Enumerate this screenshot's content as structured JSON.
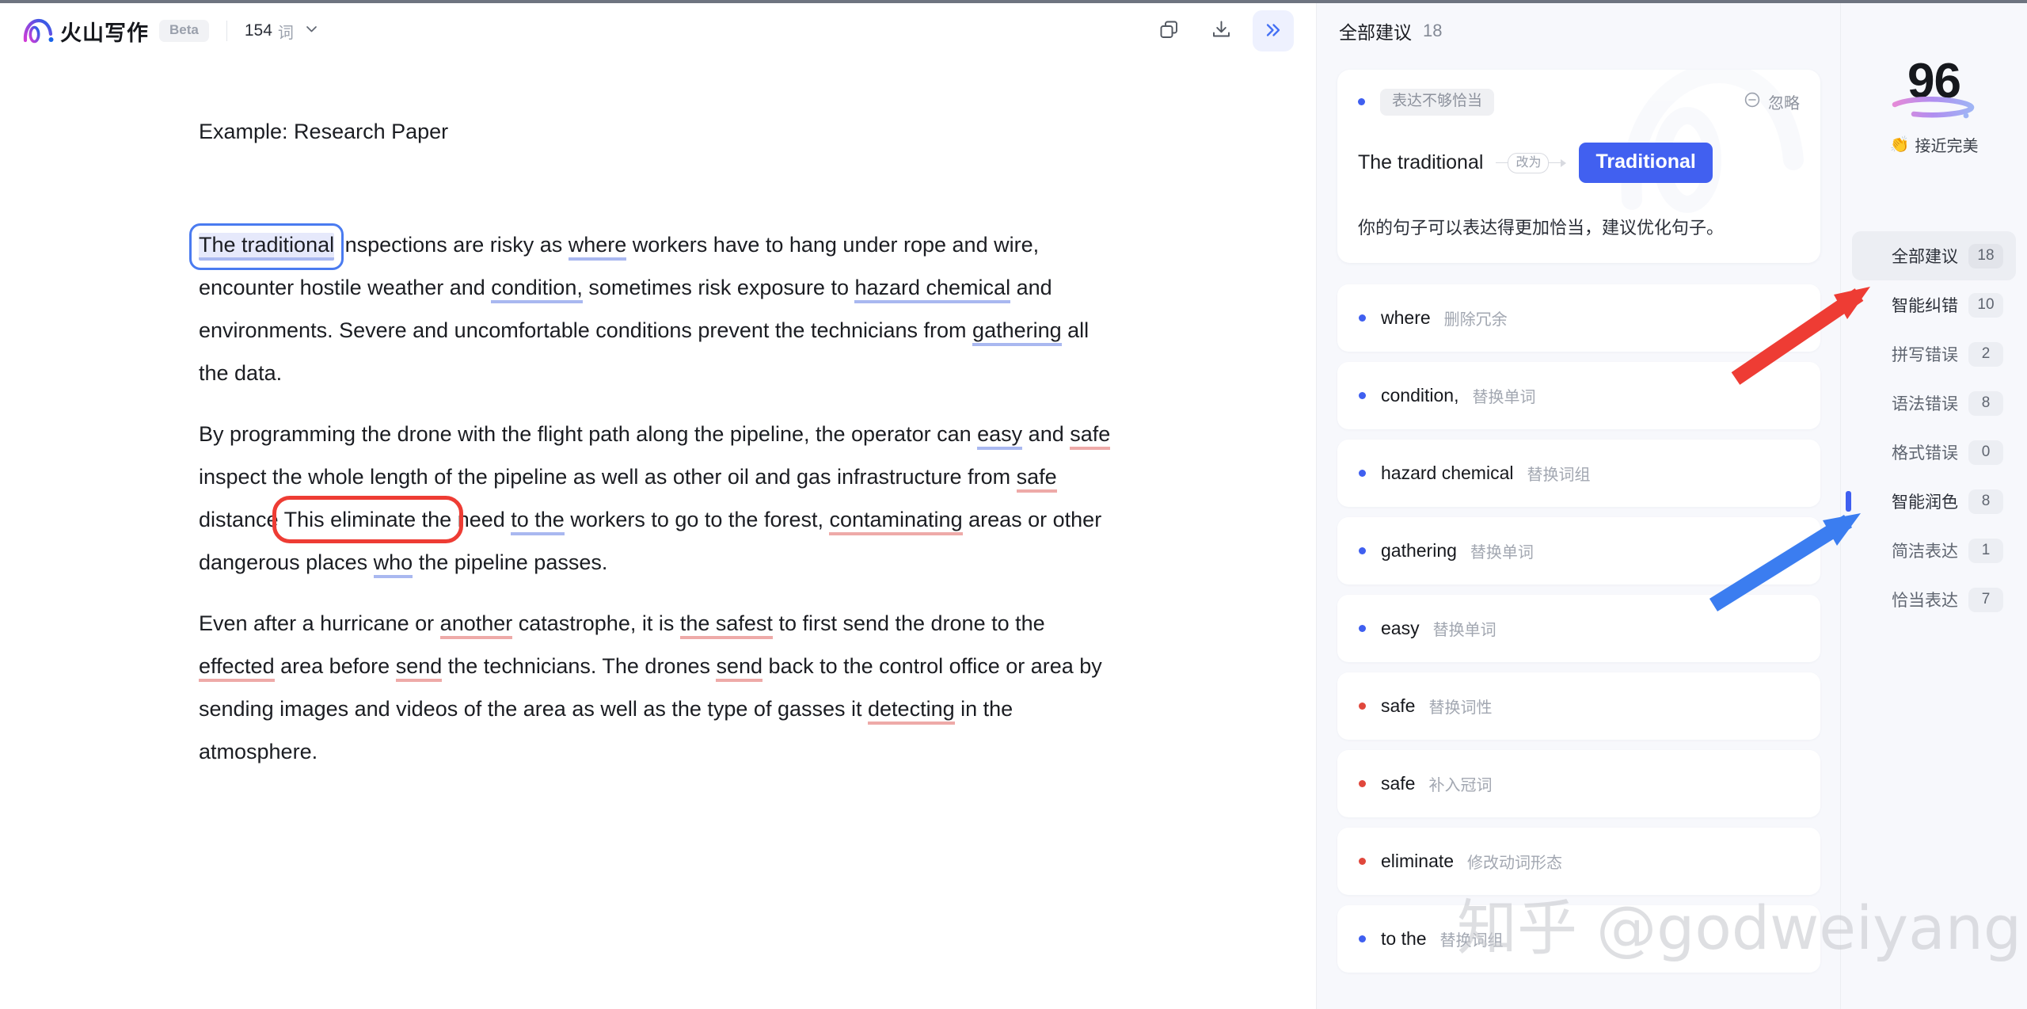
{
  "app": {
    "brand_name": "火山写作",
    "beta_label": "Beta",
    "word_count": "154",
    "word_unit": "词",
    "watermark": "知乎 @godweiyang"
  },
  "toolbar": {
    "copy_icon": "copy-icon",
    "download_icon": "download-icon",
    "collapse_icon": "double-chevron-right-icon"
  },
  "document": {
    "title": "Example: Research Paper",
    "paragraphs": [
      {
        "id": "p1",
        "runs": [
          {
            "t": "The traditional",
            "style": "selected"
          },
          {
            "t": " inspections are risky as ",
            "style": "plain"
          },
          {
            "t": "where",
            "style": "blue"
          },
          {
            "t": " workers have to hang under rope and wire, encounter hostile weather and ",
            "style": "plain"
          },
          {
            "t": "condition,",
            "style": "blue"
          },
          {
            "t": " sometimes risk exposure to ",
            "style": "plain"
          },
          {
            "t": "hazard chemical",
            "style": "blue"
          },
          {
            "t": " and environments. Severe and uncomfortable conditions prevent the technicians from ",
            "style": "plain"
          },
          {
            "t": "gathering",
            "style": "blue"
          },
          {
            "t": " all the data.",
            "style": "plain"
          }
        ]
      },
      {
        "id": "p2",
        "runs": [
          {
            "t": "By programming the drone with the flight path along the pipeline, the operator can ",
            "style": "plain"
          },
          {
            "t": "easy",
            "style": "blue"
          },
          {
            "t": " and ",
            "style": "plain"
          },
          {
            "t": "safe",
            "style": "pink"
          },
          {
            "t": " inspect the whole length of the pipeline as well as other oil and gas infrastructure from ",
            "style": "plain"
          },
          {
            "t": "safe",
            "style": "pink"
          },
          {
            "t": " distance ",
            "style": "plain"
          },
          {
            "t": "This eliminate the",
            "style": "redbox"
          },
          {
            "t": " need ",
            "style": "plain"
          },
          {
            "t": "to the",
            "style": "blue"
          },
          {
            "t": " workers to go to the forest, ",
            "style": "plain"
          },
          {
            "t": "contaminating",
            "style": "pink"
          },
          {
            "t": " areas or other dangerous places ",
            "style": "plain"
          },
          {
            "t": "who",
            "style": "blue"
          },
          {
            "t": " the pipeline passes.",
            "style": "plain"
          }
        ]
      },
      {
        "id": "p3",
        "runs": [
          {
            "t": "Even after a hurricane or ",
            "style": "plain"
          },
          {
            "t": "another",
            "style": "pink"
          },
          {
            "t": " catastrophe, it is ",
            "style": "plain"
          },
          {
            "t": "the safest",
            "style": "pink"
          },
          {
            "t": " to first send the drone to the ",
            "style": "plain"
          },
          {
            "t": "effected",
            "style": "pink"
          },
          {
            "t": " area before ",
            "style": "plain"
          },
          {
            "t": "send",
            "style": "pink"
          },
          {
            "t": " the technicians. The drones ",
            "style": "plain"
          },
          {
            "t": "send",
            "style": "pink"
          },
          {
            "t": " back to the control office or area by sending images and videos of the area as well as the type of gasses it ",
            "style": "plain"
          },
          {
            "t": "detecting",
            "style": "pink"
          },
          {
            "t": " in the atmosphere.",
            "style": "plain"
          }
        ]
      }
    ]
  },
  "suggestions_panel": {
    "header_title": "全部建议",
    "header_count": "18",
    "active_card": {
      "dot_color": "blue",
      "tag": "表达不够恰当",
      "ignore_label": "忽略",
      "ignore_icon": "minus-circle-icon",
      "original": "The traditional",
      "arrow_label": "改为",
      "replacement": "Traditional",
      "description": "你的句子可以表达得更加恰当，建议优化句子。"
    },
    "items": [
      {
        "dot": "blue",
        "word": "where",
        "kind": "删除冗余"
      },
      {
        "dot": "blue",
        "word": "condition,",
        "kind": "替换单词"
      },
      {
        "dot": "blue",
        "word": "hazard chemical",
        "kind": "替换词组"
      },
      {
        "dot": "blue",
        "word": "gathering",
        "kind": "替换单词"
      },
      {
        "dot": "blue",
        "word": "easy",
        "kind": "替换单词"
      },
      {
        "dot": "red",
        "word": "safe",
        "kind": "替换词性"
      },
      {
        "dot": "red",
        "word": "safe",
        "kind": "补入冠词"
      },
      {
        "dot": "red",
        "word": "eliminate",
        "kind": "修改动词形态"
      },
      {
        "dot": "blue",
        "word": "to the",
        "kind": "替换词组"
      }
    ]
  },
  "score_panel": {
    "score": "96",
    "score_emoji": "👏",
    "score_label": "接近完美",
    "categories": [
      {
        "name": "全部建议",
        "count": "18",
        "selected": true,
        "bar": "",
        "sub": false
      },
      {
        "name": "智能纠错",
        "count": "10",
        "selected": false,
        "bar": "red",
        "sub": false
      },
      {
        "name": "拼写错误",
        "count": "2",
        "selected": false,
        "bar": "",
        "sub": true
      },
      {
        "name": "语法错误",
        "count": "8",
        "selected": false,
        "bar": "",
        "sub": true
      },
      {
        "name": "格式错误",
        "count": "0",
        "selected": false,
        "bar": "",
        "sub": true
      },
      {
        "name": "智能润色",
        "count": "8",
        "selected": false,
        "bar": "blue",
        "sub": false
      },
      {
        "name": "简洁表达",
        "count": "1",
        "selected": false,
        "bar": "",
        "sub": true
      },
      {
        "name": "恰当表达",
        "count": "7",
        "selected": false,
        "bar": "",
        "sub": true
      }
    ]
  },
  "annotations": {
    "red_arrow_target": "智能纠错",
    "blue_arrow_target": "智能润色"
  }
}
